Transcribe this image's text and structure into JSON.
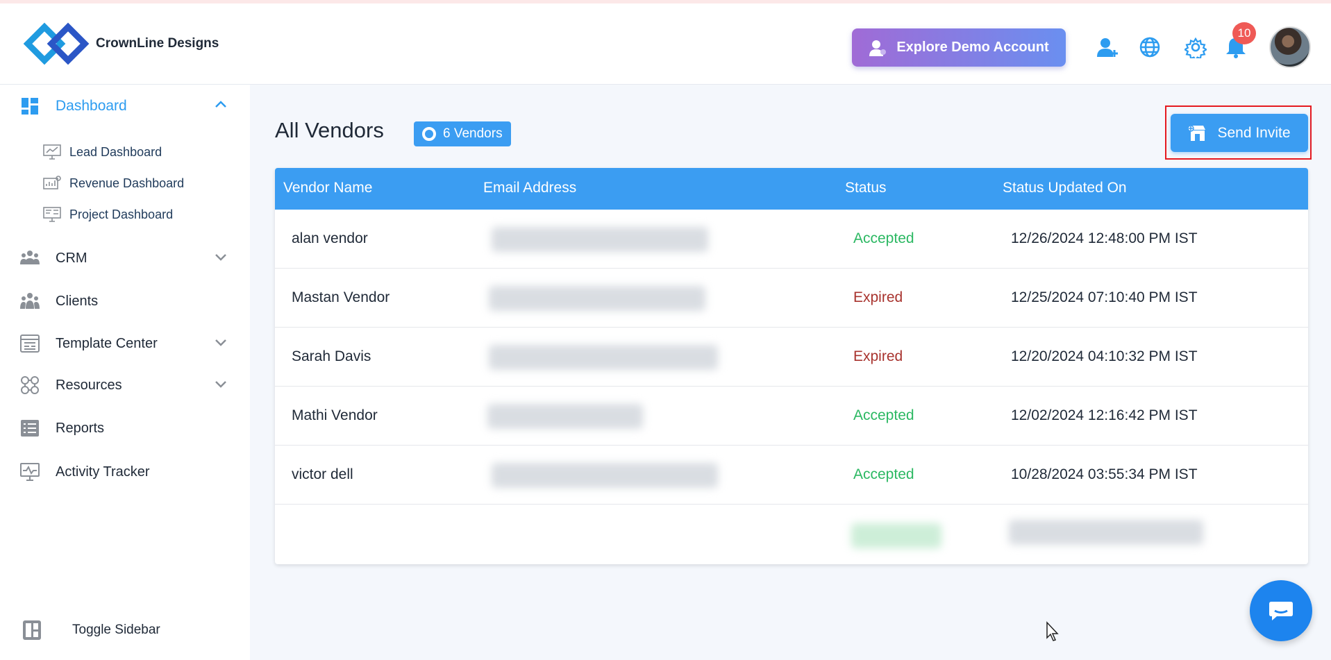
{
  "brand": {
    "name": "CrownLine Designs"
  },
  "header": {
    "demo_button": "Explore Demo Account",
    "notification_count": "10",
    "icons": [
      "add-user-icon",
      "globe-icon",
      "gear-icon",
      "bell-icon"
    ]
  },
  "sidebar": {
    "dashboard": "Dashboard",
    "sub_items": [
      "Lead Dashboard",
      "Revenue Dashboard",
      "Project Dashboard"
    ],
    "items": [
      "CRM",
      "Clients",
      "Template Center",
      "Resources",
      "Reports",
      "Activity Tracker"
    ],
    "toggle": "Toggle Sidebar"
  },
  "page": {
    "title": "All Vendors",
    "count_badge": "6 Vendors",
    "invite_button": "Send Invite"
  },
  "table": {
    "columns": [
      "Vendor Name",
      "Email Address",
      "Status",
      "Status Updated On"
    ],
    "rows": [
      {
        "name": "alan vendor",
        "status": "Accepted",
        "updated": "12/26/2024 12:48:00 PM IST"
      },
      {
        "name": "Mastan Vendor",
        "status": "Expired",
        "updated": "12/25/2024 07:10:40 PM IST"
      },
      {
        "name": "Sarah Davis",
        "status": "Expired",
        "updated": "12/20/2024 04:10:32 PM IST"
      },
      {
        "name": "Mathi Vendor",
        "status": "Accepted",
        "updated": "12/02/2024 12:16:42 PM IST"
      },
      {
        "name": "victor dell",
        "status": "Accepted",
        "updated": "10/28/2024 03:55:34 PM IST"
      }
    ]
  },
  "colors": {
    "accent": "#3b9df2",
    "accepted": "#2bb862",
    "expired": "#a8332e",
    "highlight": "#e5191f"
  }
}
